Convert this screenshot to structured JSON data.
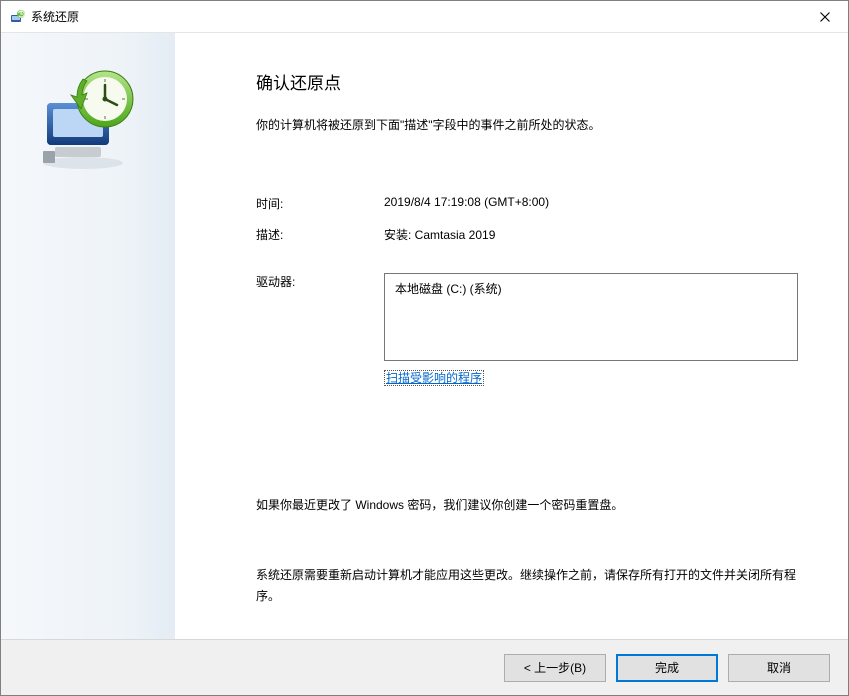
{
  "window": {
    "title": "系统还原"
  },
  "main": {
    "heading": "确认还原点",
    "intro": "你的计算机将被还原到下面\"描述\"字段中的事件之前所处的状态。",
    "time_label": "时间:",
    "time_value": "2019/8/4 17:19:08 (GMT+8:00)",
    "desc_label": "描述:",
    "desc_value": "安装: Camtasia 2019",
    "drives_label": "驱动器:",
    "drives_value": "本地磁盘 (C:) (系统)",
    "scan_link": "扫描受影响的程序",
    "note_password": "如果你最近更改了 Windows 密码，我们建议你创建一个密码重置盘。",
    "note_restart": "系统还原需要重新启动计算机才能应用这些更改。继续操作之前，请保存所有打开的文件并关闭所有程序。"
  },
  "footer": {
    "back": "< 上一步(B)",
    "finish": "完成",
    "cancel": "取消"
  }
}
